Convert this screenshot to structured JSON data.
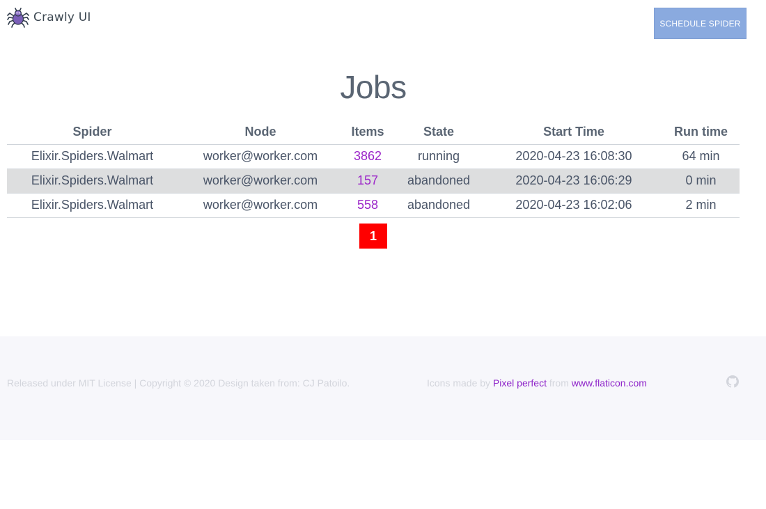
{
  "brand": {
    "name": "Crawly UI",
    "logo_icon": "spider-icon"
  },
  "header": {
    "schedule_button": "SCHEDULE SPIDER"
  },
  "page": {
    "title": "Jobs"
  },
  "table": {
    "headers": [
      "Spider",
      "Node",
      "Items",
      "State",
      "Start Time",
      "Run time"
    ],
    "rows": [
      {
        "spider": "Elixir.Spiders.Walmart",
        "node": "worker@worker.com",
        "items": "3862",
        "state": "running",
        "start_time": "2020-04-23 16:08:30",
        "run_time": "64 min"
      },
      {
        "spider": "Elixir.Spiders.Walmart",
        "node": "worker@worker.com",
        "items": "157",
        "state": "abandoned",
        "start_time": "2020-04-23 16:06:29",
        "run_time": "0 min"
      },
      {
        "spider": "Elixir.Spiders.Walmart",
        "node": "worker@worker.com",
        "items": "558",
        "state": "abandoned",
        "start_time": "2020-04-23 16:02:06",
        "run_time": "2 min"
      }
    ]
  },
  "pagination": {
    "current_page": "1"
  },
  "footer": {
    "license_text": "Released under MIT License | Copyright © 2020 Design taken from: CJ Patoilo.",
    "icons_prefix": "Icons made by ",
    "icons_author": "Pixel perfect",
    "icons_from": " from ",
    "icons_site": "www.flaticon.com",
    "github_icon": "github-icon"
  },
  "colors": {
    "accent": "#9b25c8",
    "button": "#8aaadf",
    "pager": "#ff0000",
    "footer_bg": "#f7f7fb"
  }
}
